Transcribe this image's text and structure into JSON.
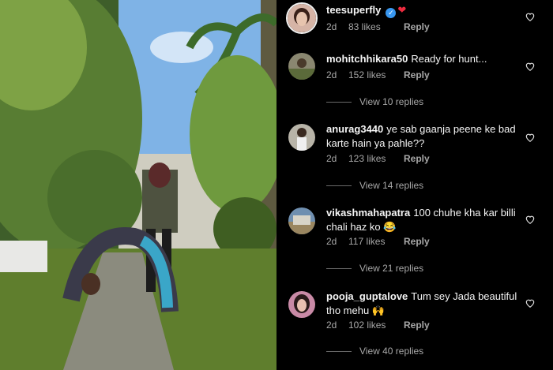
{
  "comments": [
    {
      "username": "teesuperfly",
      "text": "",
      "age": "2d",
      "likes": "83 likes",
      "reply": "Reply",
      "verified": true,
      "emoji": "❤",
      "view_replies": ""
    },
    {
      "username": "mohitchhikara50",
      "text": "Ready for hunt...",
      "age": "2d",
      "likes": "152 likes",
      "reply": "Reply",
      "view_replies": "View 10 replies"
    },
    {
      "username": "anurag3440",
      "text": "ye sab gaanja peene ke bad karte hain ya pahle??",
      "age": "2d",
      "likes": "123 likes",
      "reply": "Reply",
      "view_replies": "View 14 replies"
    },
    {
      "username": "vikashmahapatra",
      "text": "100 chuhe kha kar billi chali haz ko 😂",
      "age": "2d",
      "likes": "117 likes",
      "reply": "Reply",
      "view_replies": "View 21 replies"
    },
    {
      "username": "pooja_guptalove",
      "text": "Tum sey Jada beautiful tho mehu 🙌",
      "age": "2d",
      "likes": "102 likes",
      "reply": "Reply",
      "view_replies": "View 40 replies"
    }
  ],
  "colors": {
    "background": "#000000",
    "text": "#f5f5f5",
    "muted": "#a8a8a8",
    "verified": "#3897f0",
    "heart": "#ed2b3f"
  },
  "icons": [
    "heart-outline-icon",
    "verified-badge-icon"
  ]
}
